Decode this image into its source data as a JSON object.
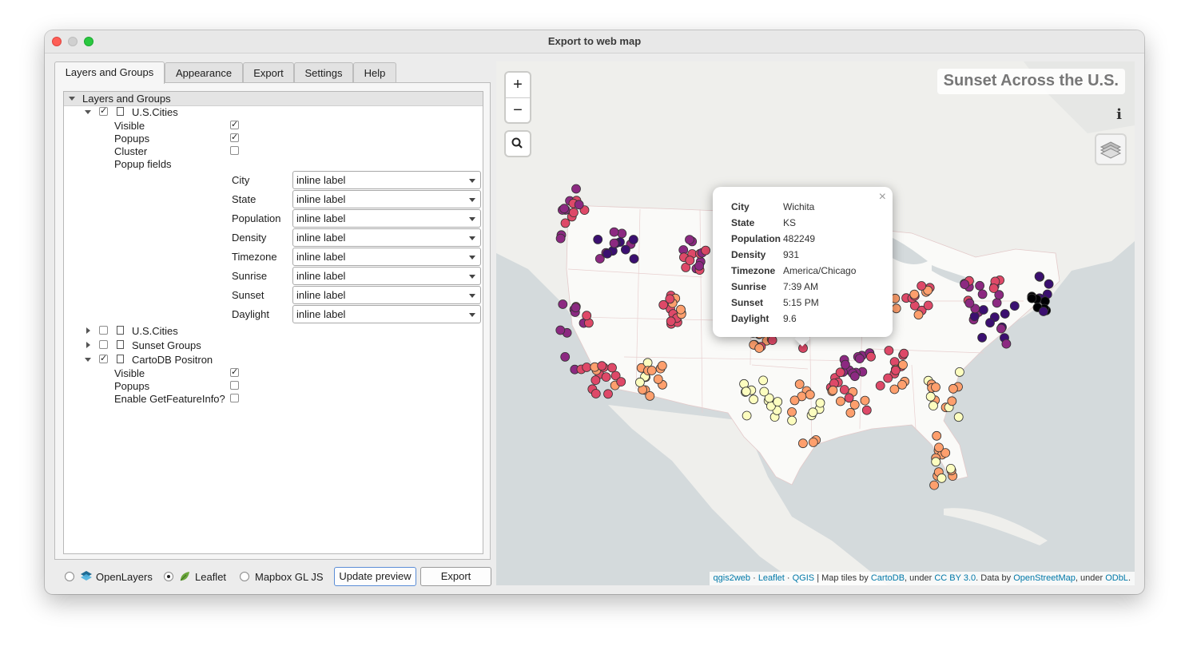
{
  "window": {
    "title": "Export to web map"
  },
  "tabs": [
    "Layers and Groups",
    "Appearance",
    "Export",
    "Settings",
    "Help"
  ],
  "tree": {
    "header": "Layers and Groups",
    "layer1": {
      "name": "U.S.Cities",
      "checked": true,
      "options": [
        {
          "label": "Visible",
          "checked": true
        },
        {
          "label": "Popups",
          "checked": true
        },
        {
          "label": "Cluster",
          "checked": false
        }
      ],
      "popup_fields_label": "Popup fields",
      "popup_fields": [
        {
          "name": "City",
          "value": "inline label"
        },
        {
          "name": "State",
          "value": "inline label"
        },
        {
          "name": "Population",
          "value": "inline label"
        },
        {
          "name": "Density",
          "value": "inline label"
        },
        {
          "name": "Timezone",
          "value": "inline label"
        },
        {
          "name": "Sunrise",
          "value": "inline label"
        },
        {
          "name": "Sunset",
          "value": "inline label"
        },
        {
          "name": "Daylight",
          "value": "inline label"
        }
      ]
    },
    "layer2": {
      "name": "U.S.Cities",
      "checked": false
    },
    "layer3": {
      "name": "Sunset Groups",
      "checked": false
    },
    "layer4": {
      "name": "CartoDB Positron",
      "checked": true,
      "options": [
        {
          "label": "Visible",
          "checked": true
        },
        {
          "label": "Popups",
          "checked": false
        },
        {
          "label": "Enable GetFeatureInfo?",
          "checked": false
        }
      ]
    }
  },
  "bottom": {
    "engines": [
      {
        "label": "OpenLayers",
        "selected": false
      },
      {
        "label": "Leaflet",
        "selected": true
      },
      {
        "label": "Mapbox GL JS",
        "selected": false
      }
    ],
    "update_label": "Update preview",
    "export_label": "Export"
  },
  "map": {
    "title": "Sunset Across the U.S.",
    "zoom_in": "+",
    "zoom_out": "−",
    "info": "i",
    "popup": {
      "City": "Wichita",
      "State": "KS",
      "Population": "482249",
      "Density": "931",
      "Timezone": "America/Chicago",
      "Sunrise": "7:39 AM",
      "Sunset": "5:15 PM",
      "Daylight": "9.6"
    },
    "attribution": {
      "qgis2web": "qgis2web",
      "sep1": " · ",
      "leaflet": "Leaflet",
      "sep2": " · ",
      "qgis": "QGIS",
      "sep3": " | Map tiles by ",
      "cartodb": "CartoDB",
      "sep4": ", under ",
      "ccby": "CC BY 3.0",
      "sep5": ". Data by ",
      "osm": "OpenStreetMap",
      "sep6": ", under ",
      "odbl": "ODbL",
      "end": "."
    },
    "colors": {
      "water": "#d4dadc",
      "land": "#f2f2ef",
      "us_land": "#fafaf8",
      "marker_ramp": [
        "#000004",
        "#3b0f70",
        "#8c2981",
        "#de4968",
        "#fe9f6d",
        "#fcfdbf"
      ]
    }
  }
}
